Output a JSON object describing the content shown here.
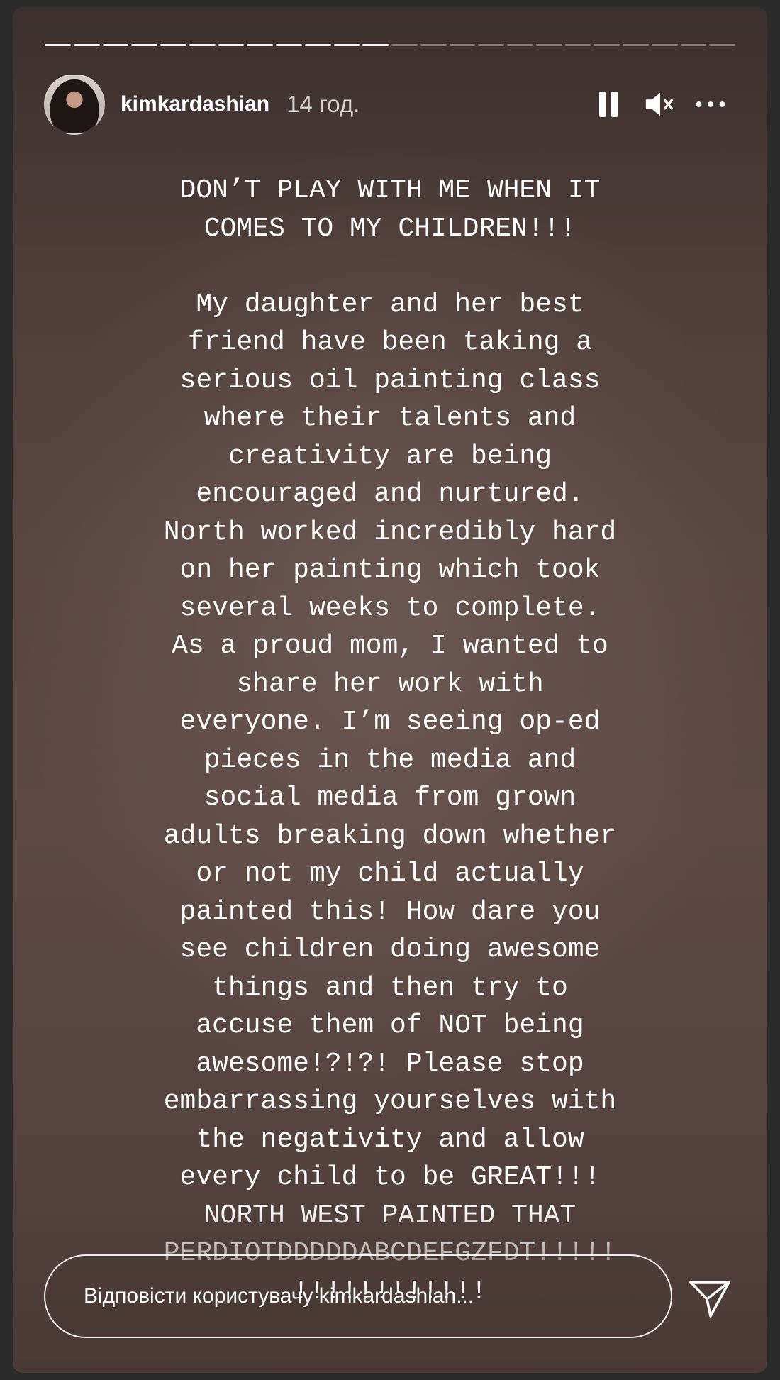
{
  "story": {
    "progress": {
      "total_segments": 24,
      "completed_segments": 12
    },
    "header": {
      "username": "kimkardashian",
      "time": "14 год.",
      "icons": [
        "pause-icon",
        "mute-icon",
        "more-options-icon"
      ]
    },
    "text": {
      "heading_lines": [
        "DON’T PLAY WITH ME WHEN IT",
        "COMES TO MY CHILDREN!!!"
      ],
      "body_lines": [
        "My daughter and her best",
        "friend have been taking a",
        "serious oil painting class",
        "where their talents and",
        "creativity are being",
        "encouraged and nurtured.",
        "North worked incredibly hard",
        "on her painting which took",
        "several weeks to complete.",
        "As a proud mom, I wanted to",
        "share her work with",
        "everyone. I’m seeing op-ed",
        "pieces in the media and",
        "social media from grown",
        "adults breaking down whether",
        "or not my child actually",
        "painted this! How dare you",
        "see children doing awesome",
        "things and then try to",
        "accuse them of NOT being",
        "awesome!?!?!  Please stop",
        "embarrassing yourselves with",
        "the negativity and allow",
        "every child to be GREAT!!!",
        "NORTH WEST PAINTED THAT",
        "PERDIOTDDDDDABCDEFGZFDT!!!!!",
        "!!!!!!!!!!!!"
      ]
    },
    "reply": {
      "placeholder": "Відповісти користувачу kimkardashian..."
    },
    "send_icon": "paper-plane-icon"
  }
}
